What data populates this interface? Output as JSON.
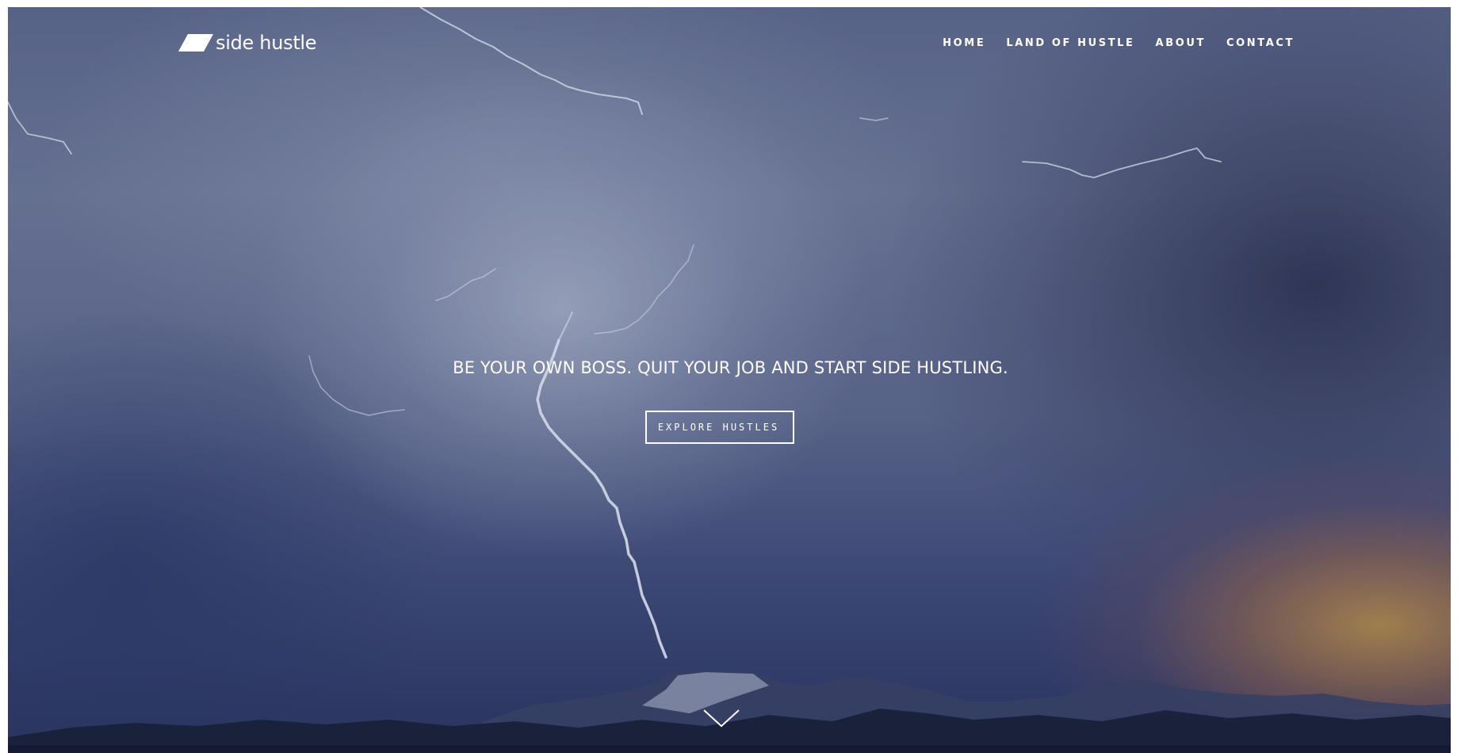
{
  "brand": {
    "name": "side hustle",
    "logo_icon": "parallelogram-logo-mark"
  },
  "nav": {
    "items": [
      {
        "label": "HOME"
      },
      {
        "label": "LAND OF HUSTLE"
      },
      {
        "label": "ABOUT"
      },
      {
        "label": "CONTACT"
      }
    ]
  },
  "hero": {
    "headline": "BE YOUR OWN BOSS. QUIT YOUR JOB AND START SIDE HUSTLING.",
    "cta_label": "EXPLORE HUSTLES",
    "scroll_icon": "chevron-down-icon",
    "background": "stormy sky with lightning over mountains at dusk"
  },
  "colors": {
    "text": "#ffffff",
    "sky": "#5e6a8e",
    "ground": "#141a30",
    "sunset": "#c8964a"
  }
}
